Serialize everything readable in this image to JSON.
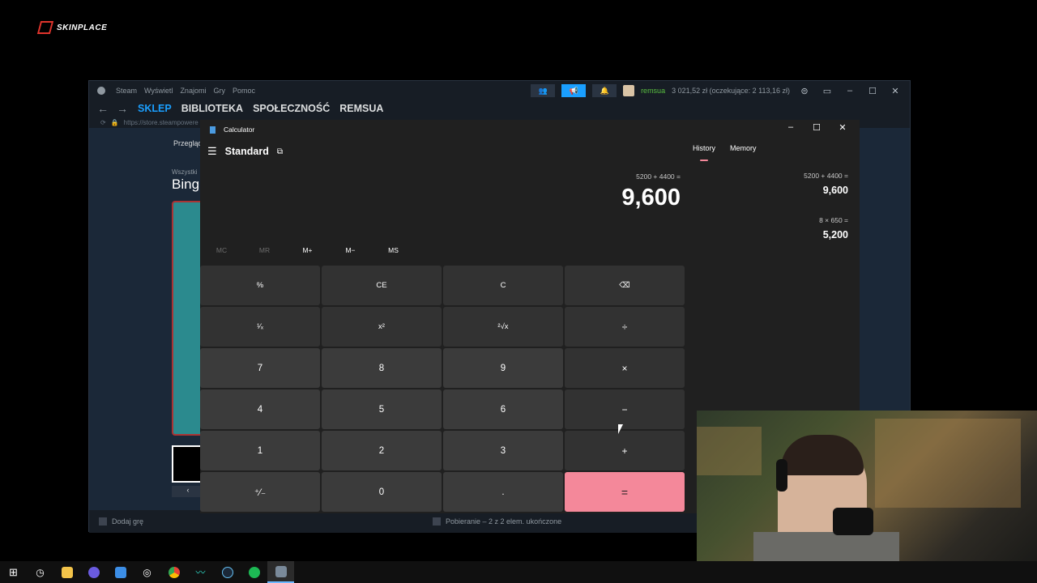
{
  "brand": {
    "logo_text": "SKINPLACE"
  },
  "steam": {
    "menu": [
      "Steam",
      "Wyświetl",
      "Znajomi",
      "Gry",
      "Pomoc"
    ],
    "user": "remsua",
    "balance": "3 021,52 zł (oczekujące: 2 113,16 zł)",
    "nav_tabs": [
      "SKLEP",
      "BIBLIOTEKA",
      "SPOŁECZNOŚĆ",
      "REMSUA"
    ],
    "url": "https://store.steampowere",
    "browse_label": "Przegląd",
    "all_label": "Wszystki",
    "game_title": "Bing",
    "thumb_nav": "‹",
    "footer_add": "Dodaj grę",
    "footer_downloads": "Pobieranie – 2 z 2 elem. ukończone"
  },
  "calculator": {
    "window_title": "Calculator",
    "mode": "Standard",
    "expression": "5200 + 4400 =",
    "display": "9,600",
    "memory_buttons": [
      "MC",
      "MR",
      "M+",
      "M−",
      "MS"
    ],
    "keys": [
      "%",
      "CE",
      "C",
      "⌫",
      "¹⁄ₓ",
      "x²",
      "²√x",
      "÷",
      "7",
      "8",
      "9",
      "×",
      "4",
      "5",
      "6",
      "−",
      "1",
      "2",
      "3",
      "+",
      "⁺⁄₋",
      "0",
      ".",
      "="
    ],
    "side_tabs": [
      "History",
      "Memory"
    ],
    "history": [
      {
        "expr": "5200   +   4400 =",
        "value": "9,600"
      },
      {
        "expr": "8   ×   650 =",
        "value": "5,200"
      }
    ]
  },
  "colors": {
    "accent_pink": "#f4889a",
    "steam_blue": "#1a9fff",
    "calc_bg": "#202020"
  },
  "taskbar": {
    "icons": [
      "windows-start-icon",
      "clock-app-icon",
      "file-explorer-icon",
      "chat-app-icon",
      "calendar-app-icon",
      "recorder-icon",
      "chrome-icon",
      "audio-app-icon",
      "steam-icon",
      "spotify-icon",
      "calculator-icon"
    ]
  }
}
